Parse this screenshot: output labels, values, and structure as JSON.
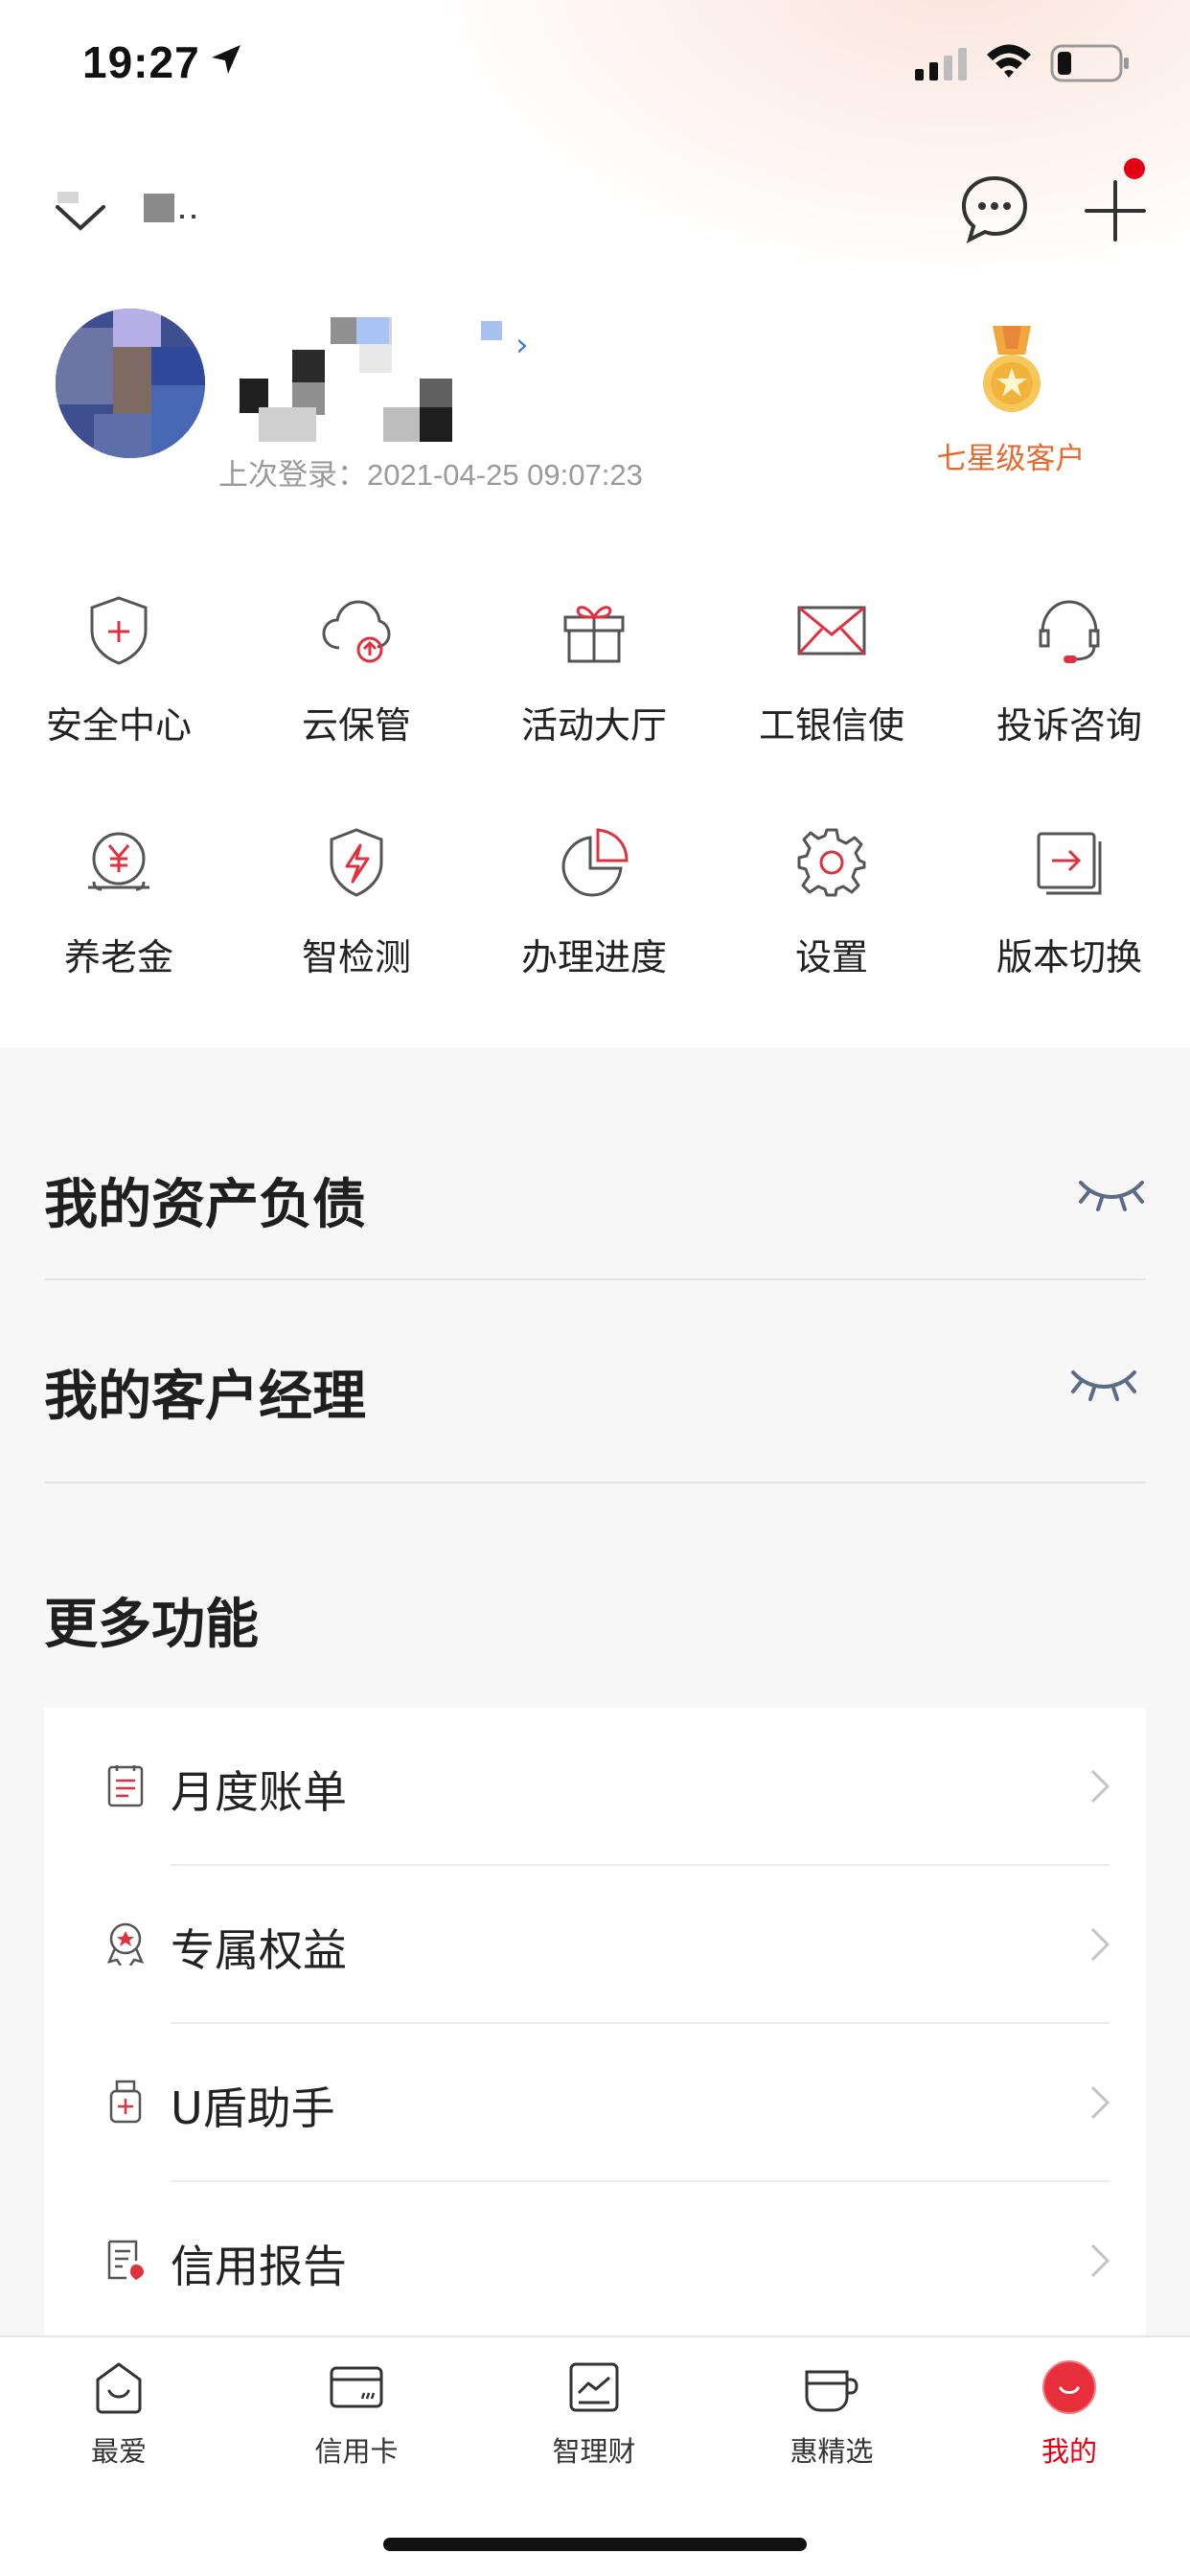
{
  "status_bar": {
    "time": "19:27"
  },
  "profile": {
    "last_login_label": "上次登录：2021-04-25 09:07:23",
    "star_level": "七星级客户"
  },
  "grid": [
    {
      "label": "安全中心",
      "icon": "shield-plus-icon"
    },
    {
      "label": "云保管",
      "icon": "cloud-upload-icon"
    },
    {
      "label": "活动大厅",
      "icon": "gift-icon"
    },
    {
      "label": "工银信使",
      "icon": "envelope-icon"
    },
    {
      "label": "投诉咨询",
      "icon": "headset-icon"
    },
    {
      "label": "养老金",
      "icon": "yuan-piggy-icon"
    },
    {
      "label": "智检测",
      "icon": "shield-bolt-icon"
    },
    {
      "label": "办理进度",
      "icon": "pie-progress-icon"
    },
    {
      "label": "设置",
      "icon": "gear-icon"
    },
    {
      "label": "版本切换",
      "icon": "switch-version-icon"
    }
  ],
  "sections": {
    "assets": "我的资产负债",
    "manager": "我的客户经理",
    "more": "更多功能"
  },
  "more_items": [
    {
      "label": "月度账单",
      "icon": "bill-icon"
    },
    {
      "label": "专属权益",
      "icon": "badge-icon"
    },
    {
      "label": "U盾助手",
      "icon": "usb-key-icon"
    },
    {
      "label": "信用报告",
      "icon": "credit-report-icon"
    }
  ],
  "tabs": [
    {
      "label": "最爱",
      "icon": "favorite-icon"
    },
    {
      "label": "信用卡",
      "icon": "credit-card-icon"
    },
    {
      "label": "智理财",
      "icon": "wealth-icon"
    },
    {
      "label": "惠精选",
      "icon": "coffee-cup-icon"
    },
    {
      "label": "我的",
      "icon": "mine-icon",
      "active": true
    }
  ],
  "colors": {
    "accent": "#e60012",
    "gold_text": "#e46a2e",
    "eye": "#5d6b8a"
  }
}
